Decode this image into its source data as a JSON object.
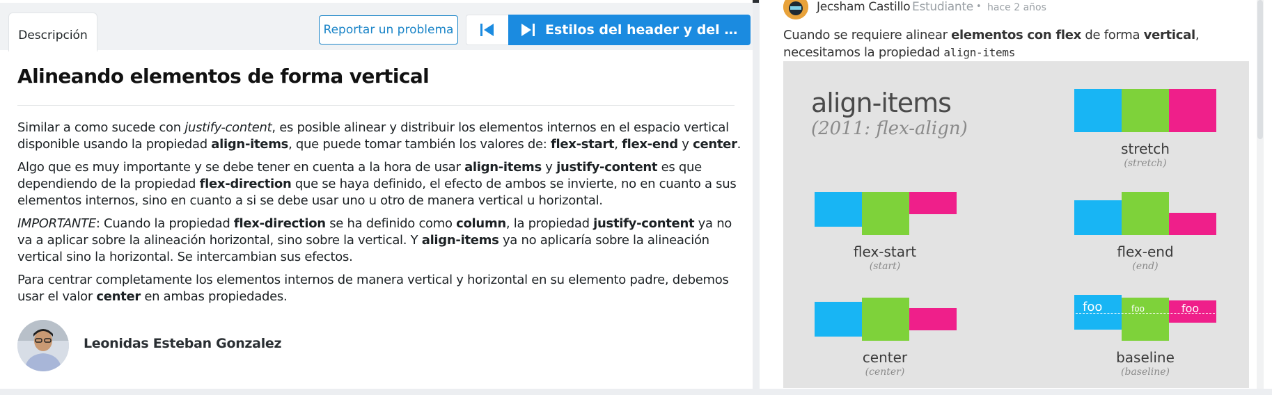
{
  "lesson": {
    "tab_label": "Descripción",
    "report_button": "Reportar un problema",
    "next_lesson_label": "Estilos del header y del menú...",
    "title": "Alineando elementos de forma vertical",
    "paragraphs": [
      [
        {
          "t": "Similar a como sucede con "
        },
        {
          "t": "justify-content",
          "i": true
        },
        {
          "t": ", es posible alinear y distribuir los elementos internos en el espacio vertical disponible usando la propiedad "
        },
        {
          "t": "align-items",
          "b": true
        },
        {
          "t": ", que puede tomar también los valores de: "
        },
        {
          "t": "flex-start",
          "b": true
        },
        {
          "t": ", "
        },
        {
          "t": "flex-end",
          "b": true
        },
        {
          "t": " y "
        },
        {
          "t": "center",
          "b": true
        },
        {
          "t": "."
        }
      ],
      [
        {
          "t": "Algo que es muy importante y se debe tener en cuenta a la hora de usar "
        },
        {
          "t": "align-items",
          "b": true
        },
        {
          "t": " y "
        },
        {
          "t": "justify-content",
          "b": true
        },
        {
          "t": " es que dependiendo de la propiedad "
        },
        {
          "t": "flex-direction",
          "b": true
        },
        {
          "t": " que se haya definido, el efecto de ambos se invierte, no en cuanto a sus elementos internos, sino en cuanto a si se debe usar uno u otro de manera vertical u horizontal."
        }
      ],
      [
        {
          "t": "IMPORTANTE",
          "i": true
        },
        {
          "t": ": Cuando la propiedad "
        },
        {
          "t": "flex-direction",
          "b": true
        },
        {
          "t": " se ha definido como "
        },
        {
          "t": "column",
          "b": true
        },
        {
          "t": ", la propiedad "
        },
        {
          "t": "justify-content",
          "b": true
        },
        {
          "t": " ya no va a aplicar sobre la alineación horizontal, sino sobre la vertical. Y "
        },
        {
          "t": "align-items",
          "b": true
        },
        {
          "t": " ya no aplicaría sobre la alineación vertical sino la horizontal. Se intercambian sus efectos."
        }
      ],
      [
        {
          "t": "Para centrar completamente los elementos internos de manera vertical y horizontal en su elemento padre, debemos usar el valor "
        },
        {
          "t": "center",
          "b": true
        },
        {
          "t": " en ambas propiedades."
        }
      ]
    ],
    "author_name": "Leonidas Esteban Gonzalez"
  },
  "comment": {
    "author": "Jecsham Castillo",
    "role": "Estudiante",
    "separator": "•",
    "time": "hace 2 años",
    "text": [
      {
        "t": "Cuando se requiere alinear "
      },
      {
        "t": "elementos con flex",
        "b": true
      },
      {
        "t": " de forma "
      },
      {
        "t": "vertical",
        "b": true
      },
      {
        "t": ", necesitamos la propiedad "
      },
      {
        "t": "align-items",
        "code": true
      }
    ]
  },
  "figure": {
    "title": "align-items",
    "subtitle": "(2011: flex-align)",
    "captions": [
      {
        "main": "stretch",
        "sub": "(stretch)"
      },
      {
        "main": "flex-start",
        "sub": "(start)"
      },
      {
        "main": "flex-end",
        "sub": "(end)"
      },
      {
        "main": "center",
        "sub": "(center)"
      },
      {
        "main": "baseline",
        "sub": "(baseline)"
      }
    ],
    "baseline_label": "foo",
    "colors": {
      "cyan": "#18b5f4",
      "green": "#7ed23a",
      "pink": "#ef1f8a"
    }
  },
  "colors": {
    "accent": "#1b8be0",
    "link": "#1b85c8"
  }
}
